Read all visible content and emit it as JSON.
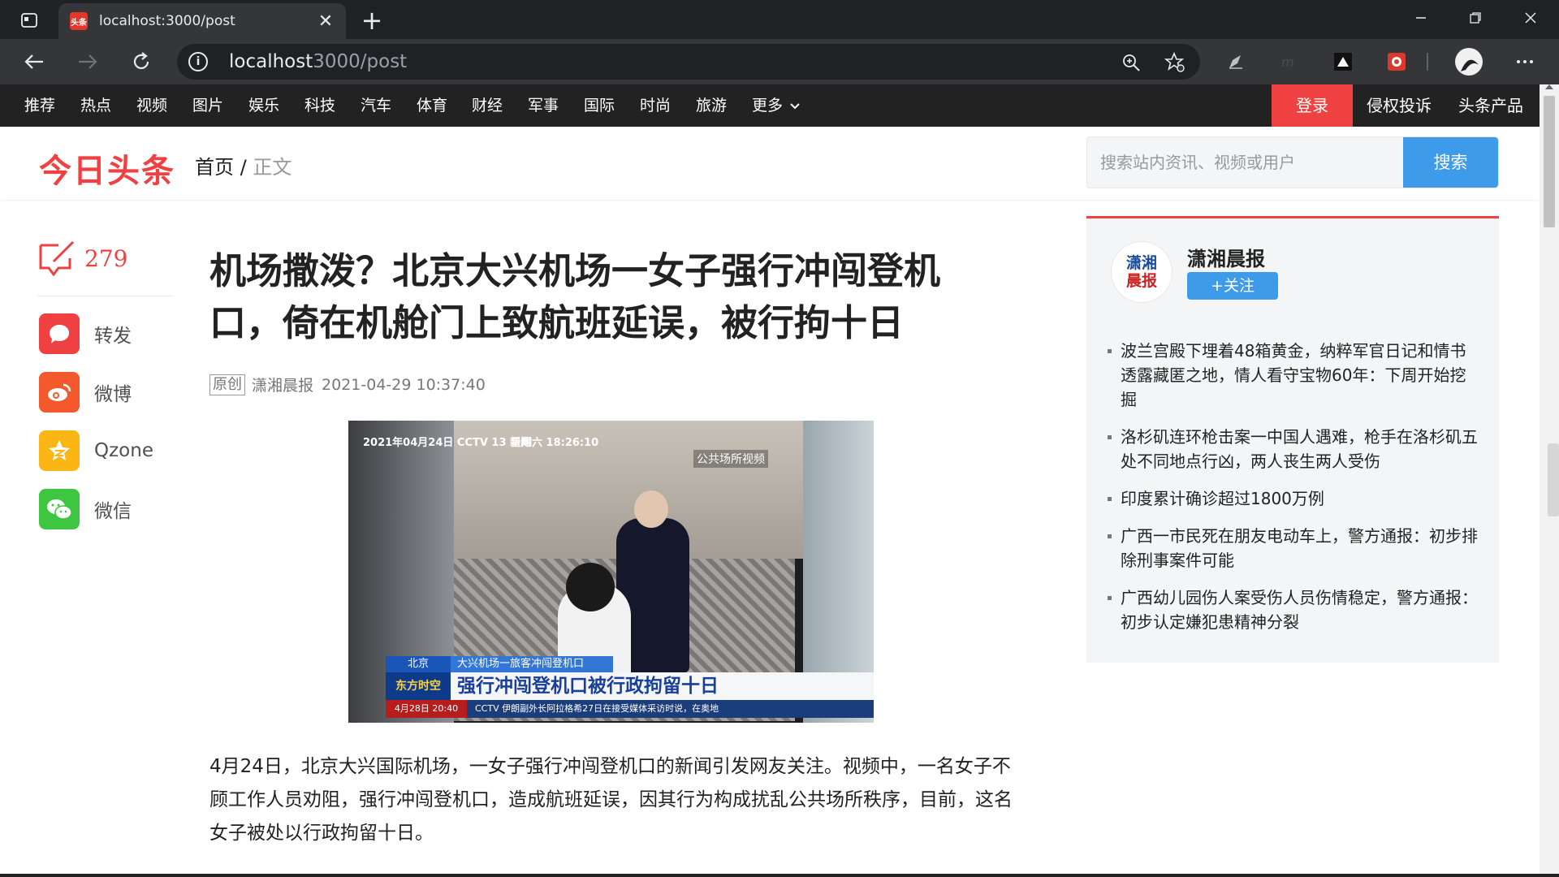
{
  "browser": {
    "tab_title": "localhost:3000/post",
    "tab_favicon_text": "头条",
    "url_host": "localhost",
    "url_rest": "3000/post"
  },
  "sitenav": {
    "categories": [
      "推荐",
      "热点",
      "视频",
      "图片",
      "娱乐",
      "科技",
      "汽车",
      "体育",
      "财经",
      "军事",
      "国际",
      "时尚",
      "旅游",
      "更多"
    ],
    "login": "登录",
    "report": "侵权投诉",
    "products": "头条产品"
  },
  "header": {
    "logo": "今日头条",
    "crumb_home": "首页",
    "crumb_sep": "/",
    "crumb_current": "正文",
    "search_placeholder": "搜索站内资讯、视频或用户",
    "search_button": "搜索"
  },
  "share": {
    "comment_count": "279",
    "items": [
      {
        "label": "转发",
        "icon": "forward-icon",
        "color": "#f04142"
      },
      {
        "label": "微博",
        "icon": "weibo-icon",
        "color": "#f3592c"
      },
      {
        "label": "Qzone",
        "icon": "qzone-icon",
        "color": "#fbb615"
      },
      {
        "label": "微信",
        "icon": "wechat-icon",
        "color": "#3fc641"
      }
    ]
  },
  "article": {
    "title": "机场撒泼？北京大兴机场一女子强行冲闯登机口，倚在机舱门上致航班延误，被行拘十日",
    "badge": "原创",
    "source": "潇湘晨报",
    "time": "2021-04-29 10:37:40",
    "image": {
      "cctv_logo": "2021年04月24日 CCTV 13 新闻",
      "cctv_time": "星期六 18:26:10",
      "public_tag": "公共场所视频",
      "lower1_left": "北京",
      "lower1_right": "大兴机场一旅客冲闯登机口",
      "lower2_left": "东方时空",
      "lower2_right": "强行冲闯登机口被行政拘留十日",
      "lower3_left": "4月28日 20:40",
      "lower3_right": "CCTV 伊朗副外长阿拉格希27日在接受媒体采访时说，在奥地"
    },
    "body": "4月24日，北京大兴国际机场，一女子强行冲闯登机口的新闻引发网友关注。视频中，一名女子不顾工作人员劝阻，强行冲闯登机口，造成航班延误，因其行为构成扰乱公共场所秩序，目前，这名女子被处以行政拘留十日。"
  },
  "sidebar": {
    "publisher_name": "潇湘晨报",
    "avatar_line1": "潇湘",
    "avatar_line2": "晨报",
    "follow_label": "+关注",
    "hot_items": [
      "波兰宫殿下埋着48箱黄金，纳粹军官日记和情书透露藏匿之地，情人看守宝物60年：下周开始挖掘",
      "洛杉矶连环枪击案一中国人遇难，枪手在洛杉矶五处不同地点行凶，两人丧生两人受伤",
      "印度累计确诊超过1800万例",
      "广西一市民死在朋友电动车上，警方通报：初步排除刑事案件可能",
      "广西幼儿园伤人案受伤人员伤情稳定，警方通报：初步认定嫌犯患精神分裂"
    ]
  }
}
